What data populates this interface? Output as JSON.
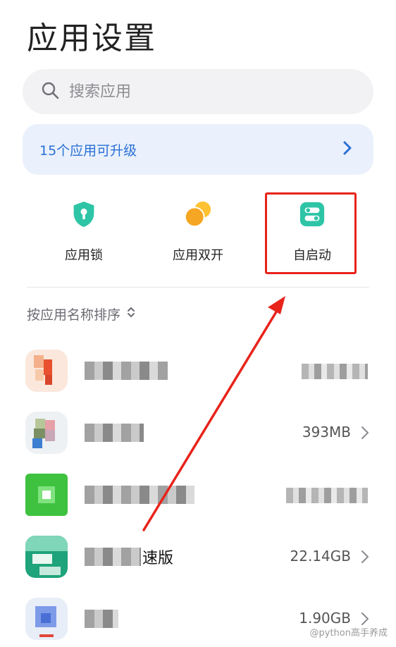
{
  "header": {
    "title": "应用设置"
  },
  "search": {
    "placeholder": "搜索应用"
  },
  "banner": {
    "text": "15个应用可升级"
  },
  "shortcuts": [
    {
      "label": "应用锁",
      "icon": "shield-lock-icon",
      "color": "#2ec4a6"
    },
    {
      "label": "应用双开",
      "icon": "dual-circles-icon",
      "color": "#f5a623"
    },
    {
      "label": "自启动",
      "icon": "toggle-switch-icon",
      "color": "#2ec4a6"
    }
  ],
  "sort": {
    "label": "按应用名称排序"
  },
  "apps": [
    {
      "name_visible": "",
      "size": ""
    },
    {
      "name_visible": "",
      "size": "393MB"
    },
    {
      "name_visible": "",
      "size": ""
    },
    {
      "name_visible": "速版",
      "size": "22.14GB"
    },
    {
      "name_visible": "",
      "size": "1.90GB"
    }
  ],
  "watermark": {
    "text": "@python高手养成"
  },
  "colors": {
    "accent": "#2a6fd6",
    "highlight": "#e8231a",
    "banner_bg": "#eaf1fc",
    "search_bg": "#f2f2f4"
  }
}
